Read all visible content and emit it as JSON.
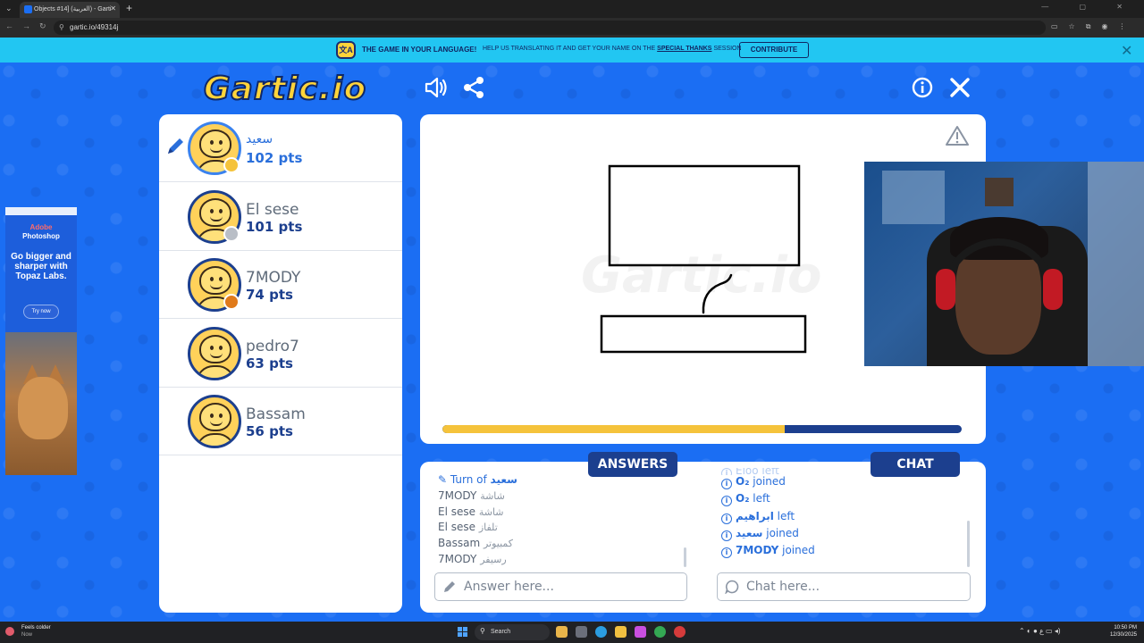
{
  "browser": {
    "tab_title": "Objects #14] (العربية) - Gartic.io",
    "tab_close": "✕",
    "new_tab": "+",
    "url": "gartic.io/49314j",
    "window_controls": "— ▢ ✕"
  },
  "banner": {
    "title": "THE GAME IN YOUR LANGUAGE!",
    "text_prefix": "HELP US TRANSLATING IT AND GET YOUR NAME ON THE",
    "text_link": "SPECIAL THANKS",
    "text_suffix": "SESSION",
    "button": "CONTRIBUTE",
    "close": "✕"
  },
  "header": {
    "logo": "Gartic.io"
  },
  "players": [
    {
      "name": "سعيد",
      "pts": "102 pts",
      "status_color": "#f5c33b",
      "drawing": true
    },
    {
      "name": "El sese",
      "pts": "101 pts",
      "status_color": "#b9bec6",
      "drawing": false
    },
    {
      "name": "7MODY",
      "pts": "74 pts",
      "status_color": "#e07a1a",
      "drawing": false
    },
    {
      "name": "pedro7",
      "pts": "63 pts",
      "status_color": "",
      "drawing": false
    },
    {
      "name": "Bassam",
      "pts": "56 pts",
      "status_color": "",
      "drawing": false
    }
  ],
  "canvas": {
    "watermark": "Gartic.io",
    "timer_progress": 0.66,
    "timer_fill_color": "#f5c33b",
    "timer_track_color": "#1c3f8e"
  },
  "ad": {
    "brand_line1": "Adobe",
    "brand_line2": "Photoshop",
    "headline": "Go bigger and sharper with Topaz Labs.",
    "cta": "Try now"
  },
  "answers": {
    "tab_label": "ANSWERS",
    "turn_prefix": "Turn of",
    "turn_name": "سعيد",
    "rows": [
      {
        "name": "7MODY",
        "guess": "شاشة"
      },
      {
        "name": "El sese",
        "guess": "شاشة"
      },
      {
        "name": "El sese",
        "guess": "تلفاز"
      },
      {
        "name": "Bassam",
        "guess": "كمبيوتر"
      },
      {
        "name": "7MODY",
        "guess": "رسيفر"
      }
    ],
    "input_placeholder": "Answer here..."
  },
  "chat": {
    "tab_label": "CHAT",
    "faded_row": "Eloo left",
    "rows": [
      {
        "who": "",
        "pre": "O₂",
        "action": "joined"
      },
      {
        "who": "",
        "pre": "O₂",
        "action": "left"
      },
      {
        "who": "ابراهيم",
        "pre": "",
        "action": "left"
      },
      {
        "who": "سعيد",
        "pre": "",
        "action": "joined"
      },
      {
        "who": "7MODY",
        "pre": "",
        "action": "joined"
      }
    ],
    "input_placeholder": "Chat here..."
  },
  "taskbar": {
    "weather_line1": "Feels colder",
    "weather_line2": "Now",
    "search": "Search",
    "time": "10:50 PM",
    "date": "12/30/2025",
    "lang": "ع"
  }
}
